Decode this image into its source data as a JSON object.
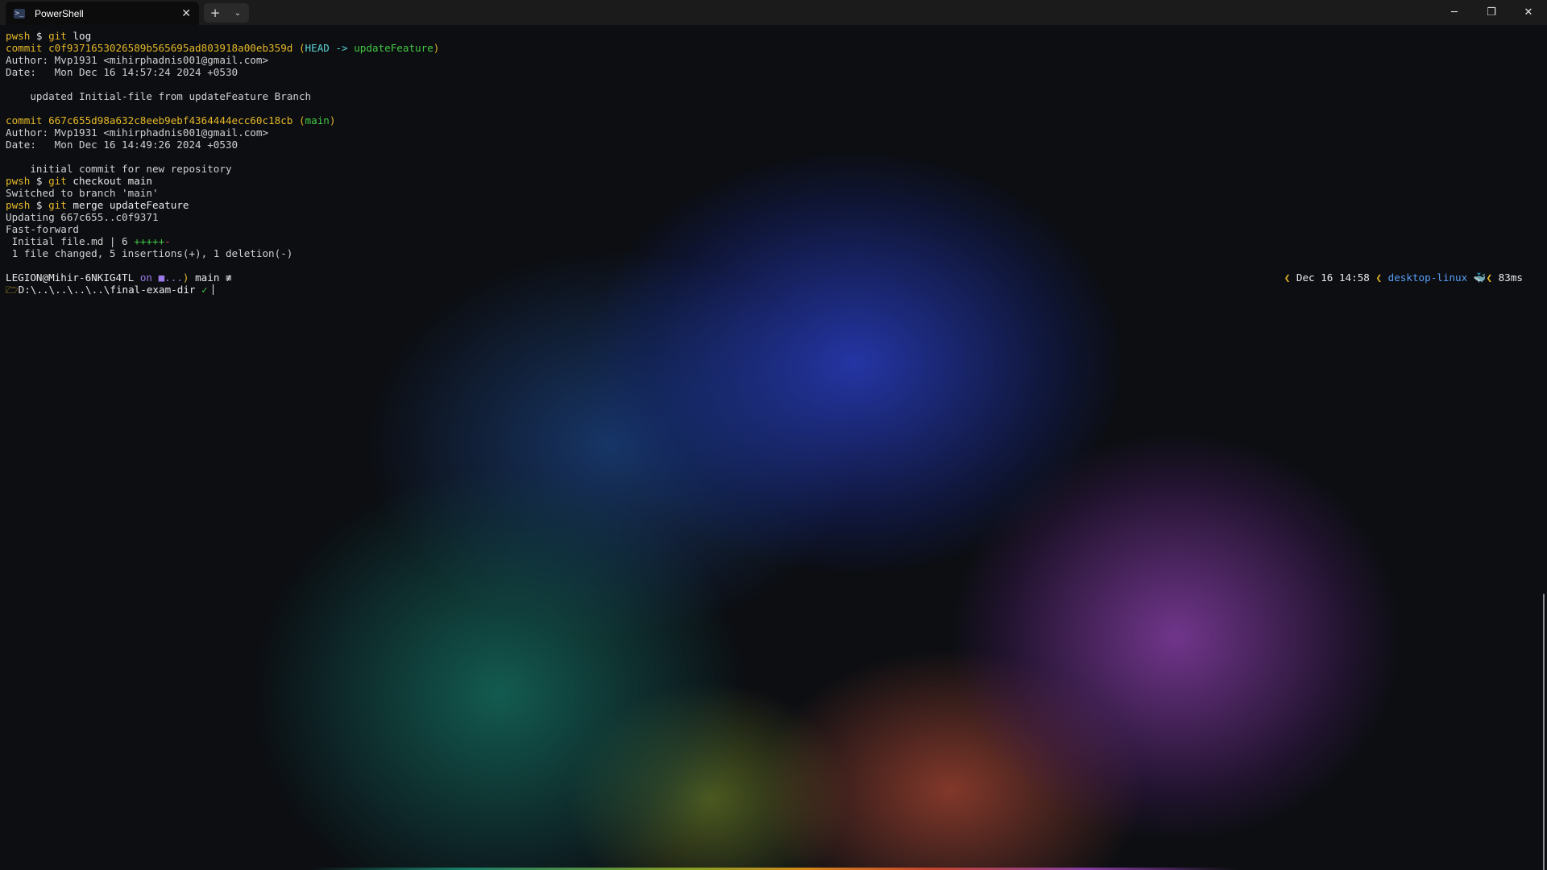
{
  "window": {
    "tab_title": "PowerShell",
    "tab_icon_glyph": ">_",
    "close_tab_glyph": "✕",
    "new_tab_glyph": "+",
    "dropdown_glyph": "⌄",
    "minimize_glyph": "─",
    "restore_glyph": "❐",
    "close_glyph": "✕"
  },
  "terminal": {
    "l1": {
      "prompt": "pwsh",
      "dollar": " $ ",
      "cmd": "git",
      "args": " log"
    },
    "l2": {
      "prefix": "commit c0f9371653026589b565695ad803918a00eb359d (",
      "head": "HEAD",
      "arrow": " -> ",
      "branch": "updateFeature",
      "suffix": ")"
    },
    "l3": "Author: Mvp1931 <mihirphadnis001@gmail.com>",
    "l4": "Date:   Mon Dec 16 14:57:24 2024 +0530",
    "l6": "    updated Initial-file from updateFeature Branch",
    "l8": {
      "prefix": "commit 667c655d98a632c8eeb9ebf4364444ecc60c18cb (",
      "branch": "main",
      "suffix": ")"
    },
    "l9": "Author: Mvp1931 <mihirphadnis001@gmail.com>",
    "l10": "Date:   Mon Dec 16 14:49:26 2024 +0530",
    "l12": "    initial commit for new repository",
    "l13": {
      "prompt": "pwsh",
      "dollar": " $ ",
      "cmd": "git",
      "args": " checkout main"
    },
    "l14": "Switched to branch 'main'",
    "l15": {
      "prompt": "pwsh",
      "dollar": " $ ",
      "cmd": "git",
      "args": " merge updateFeature"
    },
    "l16": "Updating 667c655..c0f9371",
    "l17": "Fast-forward",
    "l18": {
      "text": " Initial file.md | 6 ",
      "plus": "+++++",
      "minus": "-"
    },
    "l19": " 1 file changed, 5 insertions(+), 1 deletion(-)",
    "prompt": {
      "user_host": "LEGION@Mihir-6NKIG4TL",
      "on": " on ",
      "os_glyph": "■",
      "ellipsis": "...",
      "sep": ") ",
      "git_glyph": "",
      "branch": "main",
      "status": " ≢",
      "folder_glyph": "🗁",
      "path": "D:\\..\\..\\..\\..\\final-exam-dir",
      "check": " ✓"
    },
    "right_prompt": {
      "sep1": "❮ ",
      "time": "Dec 16 14:58",
      "sep2": " ❮ ",
      "host": "desktop-linux",
      "whale": " 🐳",
      "sep3": "❮ ",
      "duration": "83ms"
    }
  },
  "colors": {
    "prompt": "#e5b828",
    "branch": "#43c943",
    "head": "#5ed4d4",
    "docker": "#5a9ef5"
  }
}
